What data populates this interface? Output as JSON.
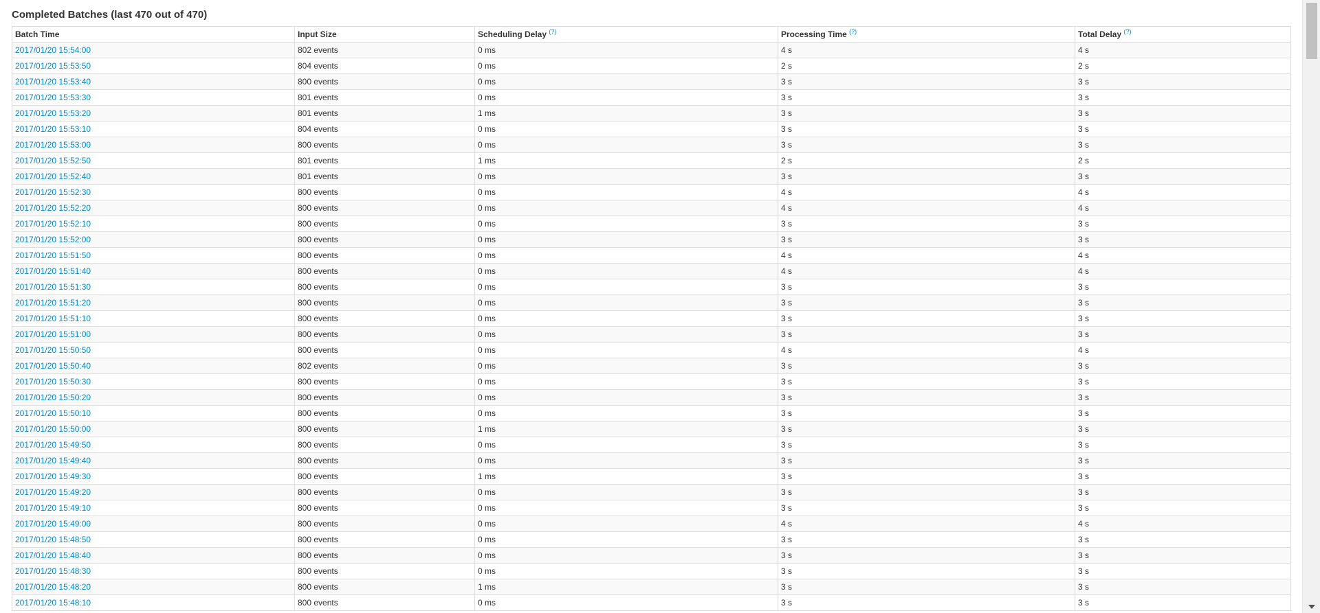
{
  "section": {
    "title": "Completed Batches (last 470 out of 470)"
  },
  "table": {
    "columns": [
      {
        "label": "Batch Time",
        "help": ""
      },
      {
        "label": "Input Size",
        "help": ""
      },
      {
        "label": "Scheduling Delay",
        "help": "(?)"
      },
      {
        "label": "Processing Time",
        "help": "(?)"
      },
      {
        "label": "Total Delay",
        "help": "(?)"
      }
    ],
    "rows": [
      [
        "2017/01/20 15:54:00",
        "802 events",
        "0 ms",
        "4 s",
        "4 s"
      ],
      [
        "2017/01/20 15:53:50",
        "804 events",
        "0 ms",
        "2 s",
        "2 s"
      ],
      [
        "2017/01/20 15:53:40",
        "800 events",
        "0 ms",
        "3 s",
        "3 s"
      ],
      [
        "2017/01/20 15:53:30",
        "801 events",
        "0 ms",
        "3 s",
        "3 s"
      ],
      [
        "2017/01/20 15:53:20",
        "801 events",
        "1 ms",
        "3 s",
        "3 s"
      ],
      [
        "2017/01/20 15:53:10",
        "804 events",
        "0 ms",
        "3 s",
        "3 s"
      ],
      [
        "2017/01/20 15:53:00",
        "800 events",
        "0 ms",
        "3 s",
        "3 s"
      ],
      [
        "2017/01/20 15:52:50",
        "801 events",
        "1 ms",
        "2 s",
        "2 s"
      ],
      [
        "2017/01/20 15:52:40",
        "801 events",
        "0 ms",
        "3 s",
        "3 s"
      ],
      [
        "2017/01/20 15:52:30",
        "800 events",
        "0 ms",
        "4 s",
        "4 s"
      ],
      [
        "2017/01/20 15:52:20",
        "800 events",
        "0 ms",
        "4 s",
        "4 s"
      ],
      [
        "2017/01/20 15:52:10",
        "800 events",
        "0 ms",
        "3 s",
        "3 s"
      ],
      [
        "2017/01/20 15:52:00",
        "800 events",
        "0 ms",
        "3 s",
        "3 s"
      ],
      [
        "2017/01/20 15:51:50",
        "800 events",
        "0 ms",
        "4 s",
        "4 s"
      ],
      [
        "2017/01/20 15:51:40",
        "800 events",
        "0 ms",
        "4 s",
        "4 s"
      ],
      [
        "2017/01/20 15:51:30",
        "800 events",
        "0 ms",
        "3 s",
        "3 s"
      ],
      [
        "2017/01/20 15:51:20",
        "800 events",
        "0 ms",
        "3 s",
        "3 s"
      ],
      [
        "2017/01/20 15:51:10",
        "800 events",
        "0 ms",
        "3 s",
        "3 s"
      ],
      [
        "2017/01/20 15:51:00",
        "800 events",
        "0 ms",
        "3 s",
        "3 s"
      ],
      [
        "2017/01/20 15:50:50",
        "800 events",
        "0 ms",
        "4 s",
        "4 s"
      ],
      [
        "2017/01/20 15:50:40",
        "802 events",
        "0 ms",
        "3 s",
        "3 s"
      ],
      [
        "2017/01/20 15:50:30",
        "800 events",
        "0 ms",
        "3 s",
        "3 s"
      ],
      [
        "2017/01/20 15:50:20",
        "800 events",
        "0 ms",
        "3 s",
        "3 s"
      ],
      [
        "2017/01/20 15:50:10",
        "800 events",
        "0 ms",
        "3 s",
        "3 s"
      ],
      [
        "2017/01/20 15:50:00",
        "800 events",
        "1 ms",
        "3 s",
        "3 s"
      ],
      [
        "2017/01/20 15:49:50",
        "800 events",
        "0 ms",
        "3 s",
        "3 s"
      ],
      [
        "2017/01/20 15:49:40",
        "800 events",
        "0 ms",
        "3 s",
        "3 s"
      ],
      [
        "2017/01/20 15:49:30",
        "800 events",
        "1 ms",
        "3 s",
        "3 s"
      ],
      [
        "2017/01/20 15:49:20",
        "800 events",
        "0 ms",
        "3 s",
        "3 s"
      ],
      [
        "2017/01/20 15:49:10",
        "800 events",
        "0 ms",
        "3 s",
        "3 s"
      ],
      [
        "2017/01/20 15:49:00",
        "800 events",
        "0 ms",
        "4 s",
        "4 s"
      ],
      [
        "2017/01/20 15:48:50",
        "800 events",
        "0 ms",
        "3 s",
        "3 s"
      ],
      [
        "2017/01/20 15:48:40",
        "800 events",
        "0 ms",
        "3 s",
        "3 s"
      ],
      [
        "2017/01/20 15:48:30",
        "800 events",
        "0 ms",
        "3 s",
        "3 s"
      ],
      [
        "2017/01/20 15:48:20",
        "800 events",
        "1 ms",
        "3 s",
        "3 s"
      ],
      [
        "2017/01/20 15:48:10",
        "800 events",
        "0 ms",
        "3 s",
        "3 s"
      ]
    ]
  },
  "colors": {
    "link": "#0088cc",
    "text": "#333333",
    "border": "#dddddd",
    "row_stripe": "#f9f9f9",
    "scrollbar_track": "#f1f1f1",
    "scrollbar_thumb": "#c1c1c1"
  },
  "icons": {
    "scroll_down": "chevron-down-icon"
  }
}
